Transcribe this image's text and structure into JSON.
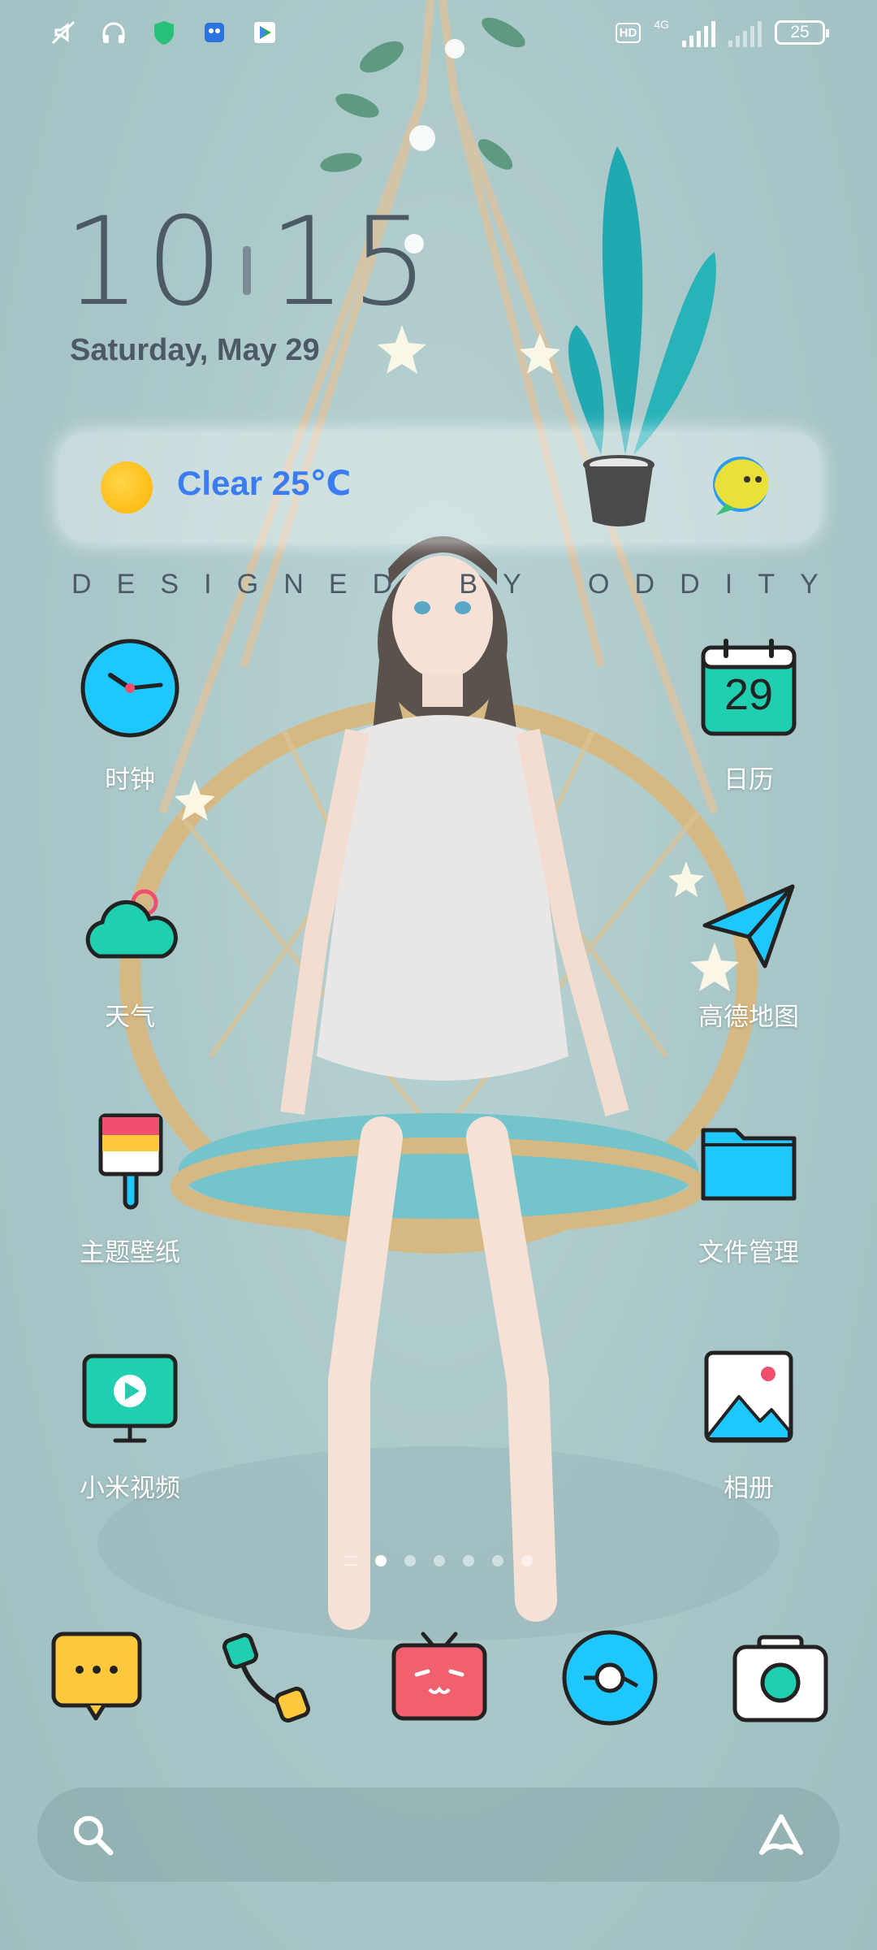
{
  "status_bar": {
    "hd": "HD",
    "network": "4G",
    "battery": "25"
  },
  "clock": {
    "hour": "10",
    "minute": "15"
  },
  "date": "Saturday, May 29",
  "weather": {
    "text": "Clear 25℃"
  },
  "banner": [
    "D",
    "E",
    "S",
    "I",
    "G",
    "N",
    "E",
    "D",
    "",
    "B",
    "Y",
    "",
    "O",
    "D",
    "D",
    "I",
    "T",
    "Y"
  ],
  "apps": {
    "clock": "时钟",
    "calendar": "日历",
    "calendar_day": "29",
    "weather": "天气",
    "maps": "高德地图",
    "themes": "主题壁纸",
    "files": "文件管理",
    "video": "小米视频",
    "gallery": "相册"
  },
  "page_indicator": {
    "pages": 6,
    "current": 1
  },
  "dock": [
    "messages",
    "phone",
    "bilibili",
    "browser",
    "camera"
  ],
  "colors": {
    "accent": "#1ec8ff",
    "teal": "#1fcfb0",
    "weather_text": "#3b7df0"
  }
}
